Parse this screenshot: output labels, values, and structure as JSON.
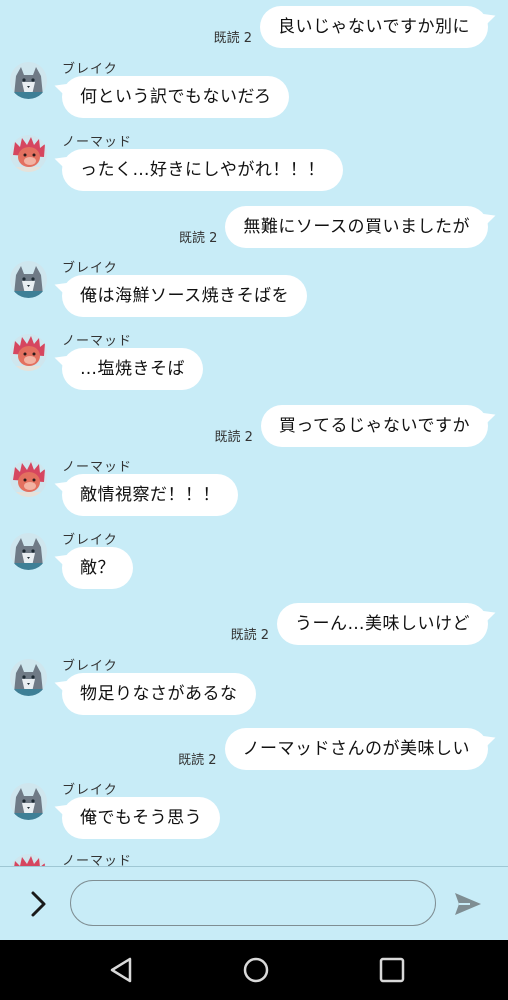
{
  "messages": [
    {
      "type": "out",
      "read": "既読 2",
      "text": "良いじゃないですか別に"
    },
    {
      "type": "in",
      "avatar": "blake",
      "name": "ブレイク",
      "text": "何という訳でもないだろ"
    },
    {
      "type": "in",
      "avatar": "nomad",
      "name": "ノーマッド",
      "text": "ったく…好きにしやがれ！！！"
    },
    {
      "type": "out",
      "read": "既読 2",
      "text": "無難にソースの買いましたが"
    },
    {
      "type": "in",
      "avatar": "blake",
      "name": "ブレイク",
      "text": "俺は海鮮ソース焼きそばを"
    },
    {
      "type": "in",
      "avatar": "nomad",
      "name": "ノーマッド",
      "text": "…塩焼きそば"
    },
    {
      "type": "out",
      "read": "既読 2",
      "text": "買ってるじゃないですか"
    },
    {
      "type": "in",
      "avatar": "nomad",
      "name": "ノーマッド",
      "text": "敵情視察だ！！！"
    },
    {
      "type": "in",
      "avatar": "blake",
      "name": "ブレイク",
      "text": "敵？"
    },
    {
      "type": "out",
      "read": "既読 2",
      "text": "うーん…美味しいけど"
    },
    {
      "type": "in",
      "avatar": "blake",
      "name": "ブレイク",
      "text": "物足りなさがあるな"
    },
    {
      "type": "out",
      "read": "既読 2",
      "text": "ノーマッドさんのが美味しい"
    },
    {
      "type": "in",
      "avatar": "blake",
      "name": "ブレイク",
      "text": "俺でもそう思う"
    },
    {
      "type": "in",
      "avatar": "nomad",
      "name": "ノーマッド",
      "text": ""
    }
  ],
  "input": {
    "placeholder": "",
    "value": ""
  },
  "icons": {
    "expand": "chevron-right-icon",
    "send": "send-icon",
    "nav_back": "triangle-back-icon",
    "nav_home": "circle-home-icon",
    "nav_recent": "square-recent-icon"
  },
  "colors": {
    "background": "#c8ecf7",
    "bubble": "#ffffff",
    "navbar": "#000000",
    "blake_fur": "#6f7a86",
    "nomad_hair": "#d6465f"
  }
}
